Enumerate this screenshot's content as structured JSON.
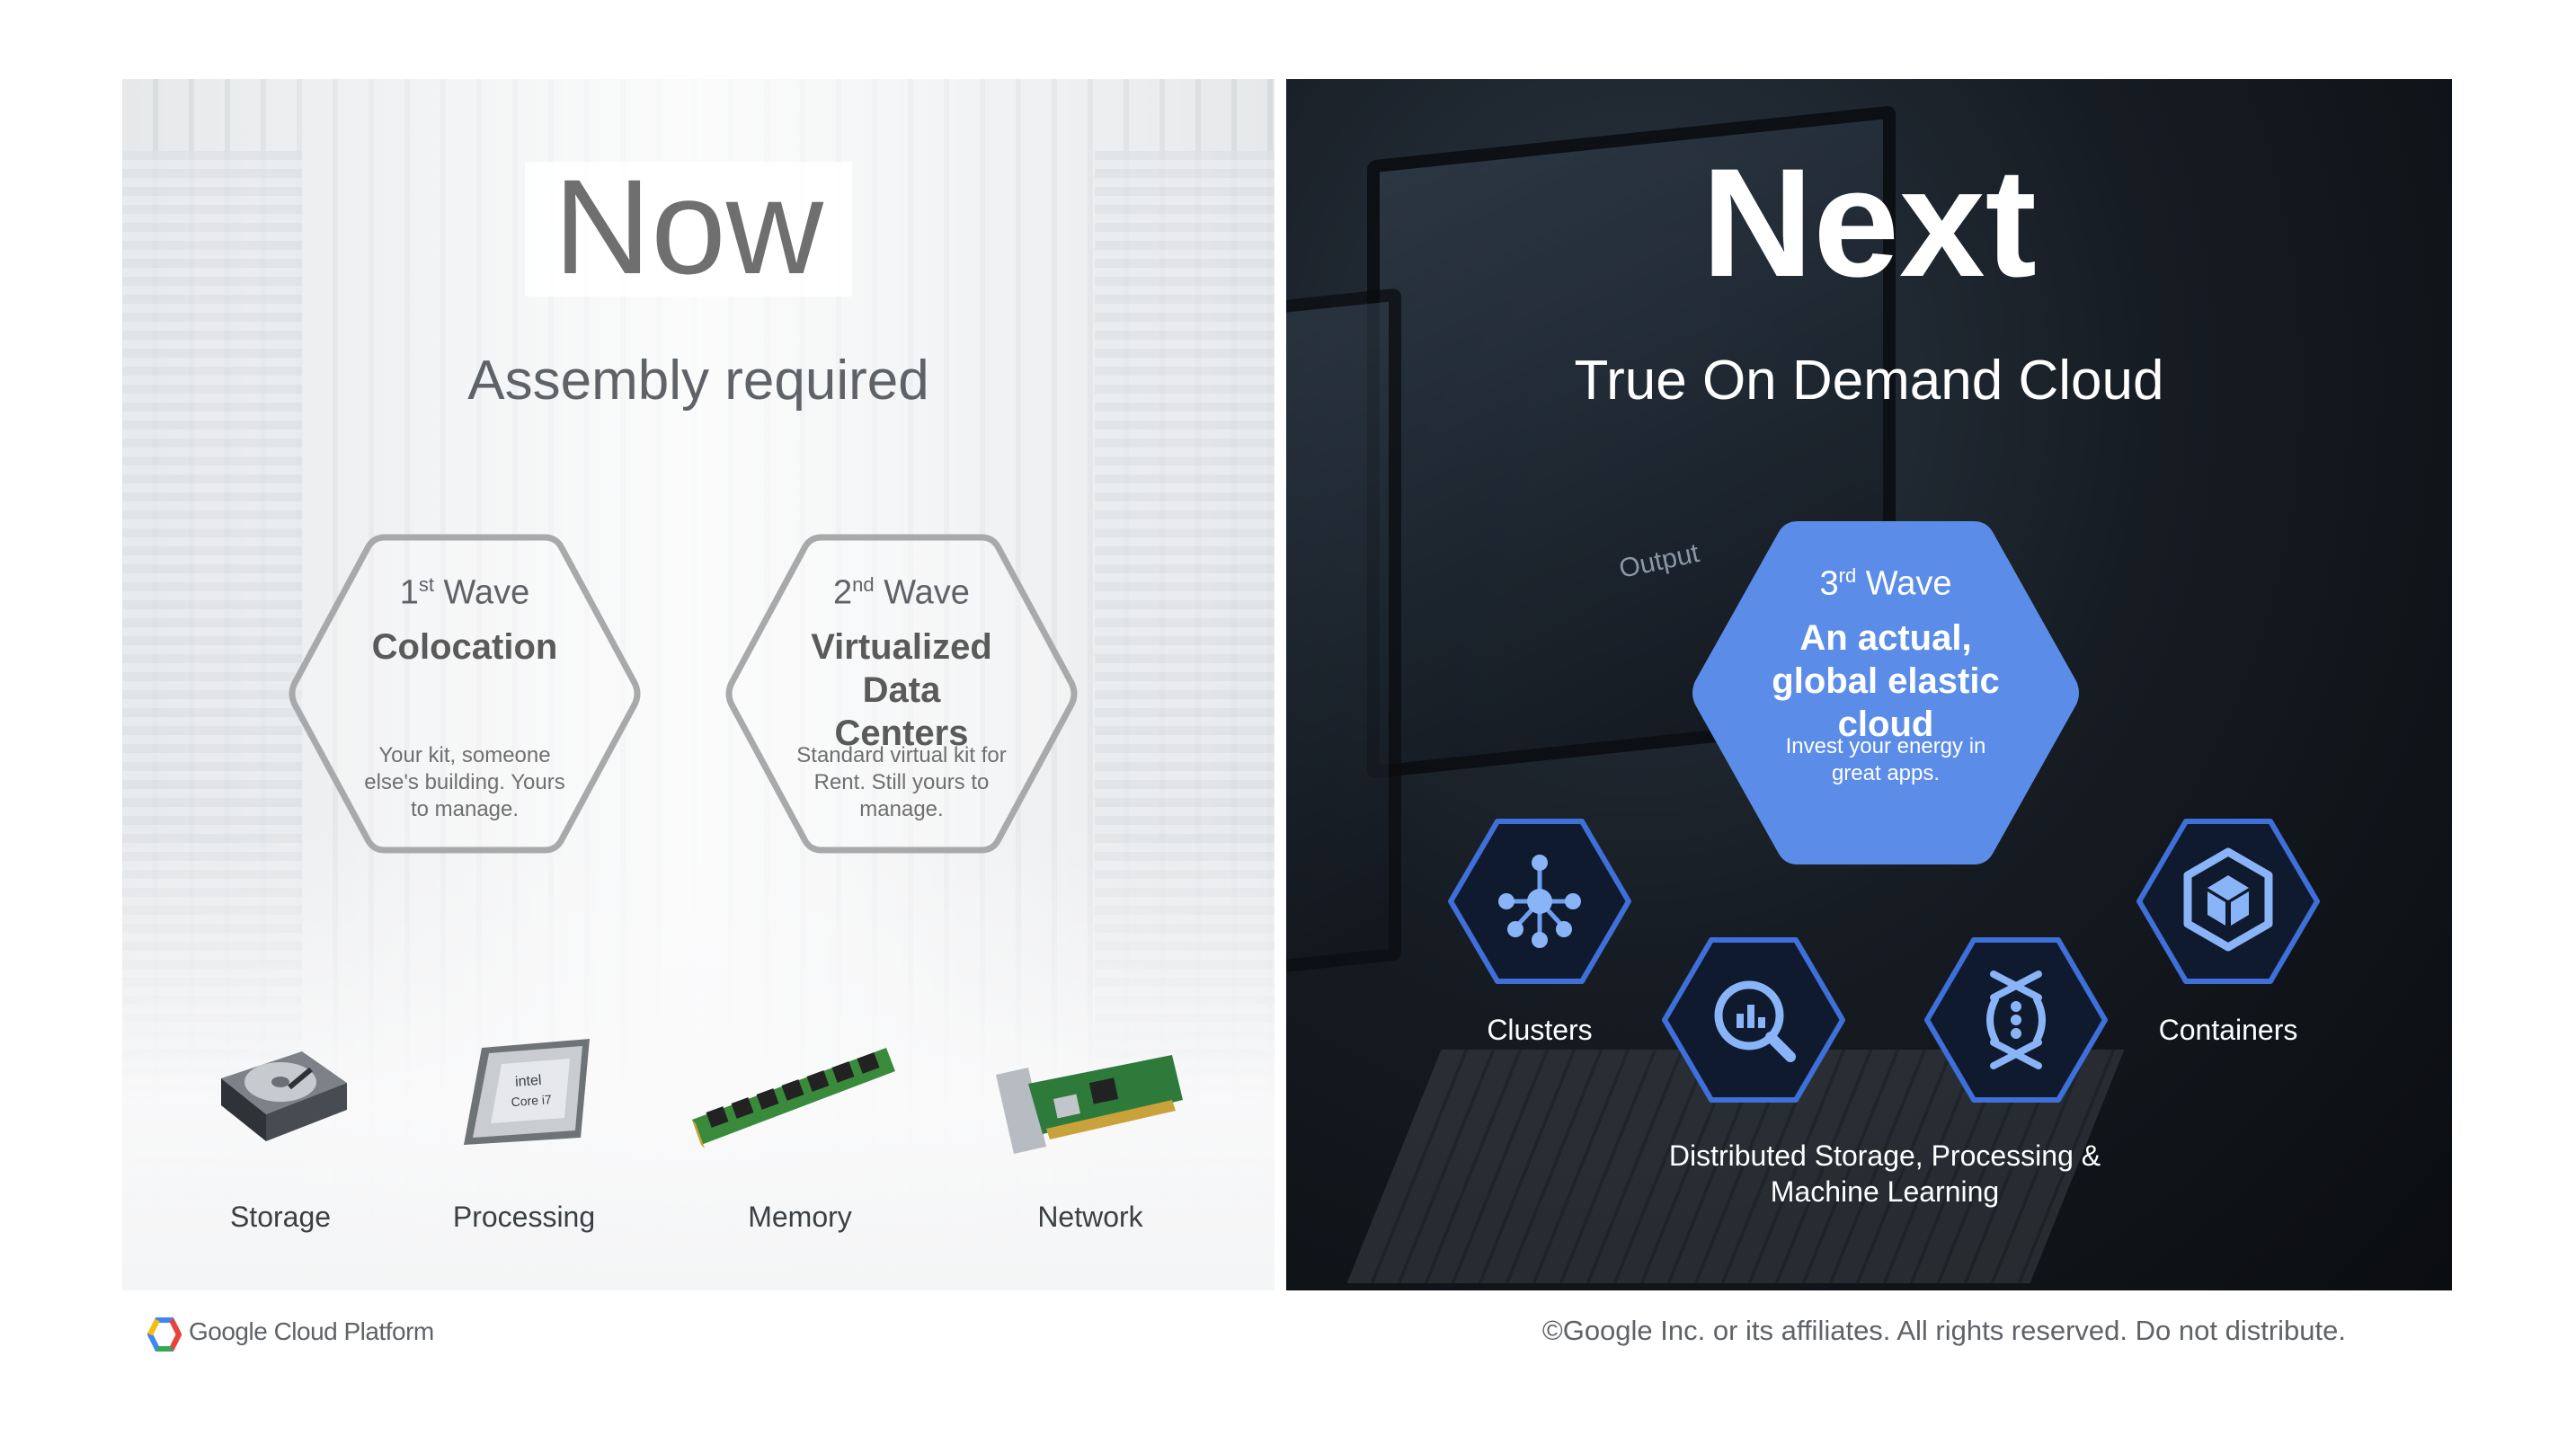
{
  "left": {
    "title": "Now",
    "subtitle": "Assembly required",
    "waves": [
      {
        "ordinal": "1",
        "suffix": "st",
        "label": "Wave",
        "title": "Colocation",
        "desc": "Your kit, someone else's building. Yours to manage."
      },
      {
        "ordinal": "2",
        "suffix": "nd",
        "label": "Wave",
        "title": "Virtualized Data Centers",
        "desc": "Standard virtual kit for Rent. Still yours to manage."
      }
    ],
    "hardware": [
      {
        "label": "Storage",
        "icon": "hard-drive-icon"
      },
      {
        "label": "Processing",
        "icon": "cpu-chip-icon"
      },
      {
        "label": "Memory",
        "icon": "ram-module-icon"
      },
      {
        "label": "Network",
        "icon": "network-card-icon"
      }
    ],
    "chip_brand": "intel",
    "chip_model": "Core i7"
  },
  "right": {
    "title": "Next",
    "subtitle": "True On Demand Cloud",
    "screen_label": "Output",
    "wave": {
      "ordinal": "3",
      "suffix": "rd",
      "label": "Wave",
      "title": "An actual, global elastic cloud",
      "desc": "Invest your energy in great apps."
    },
    "services": [
      {
        "label": "Clusters",
        "icon": "clusters-icon"
      },
      {
        "label": "Containers",
        "icon": "containers-icon"
      },
      {
        "label": "Distributed Storage, Processing & Machine Learning",
        "icons": [
          "bigquery-icon",
          "dataflow-icon"
        ]
      }
    ]
  },
  "footer": {
    "brand": "Google Cloud Platform",
    "copyright": "©Google Inc. or its affiliates. All rights reserved. Do not distribute."
  },
  "colors": {
    "accent_blue": "#5b8de8",
    "hex_outline_dark": "#3f6fd8",
    "hex_outline_light": "#a7a9ab",
    "text_gray": "#5f6368"
  }
}
